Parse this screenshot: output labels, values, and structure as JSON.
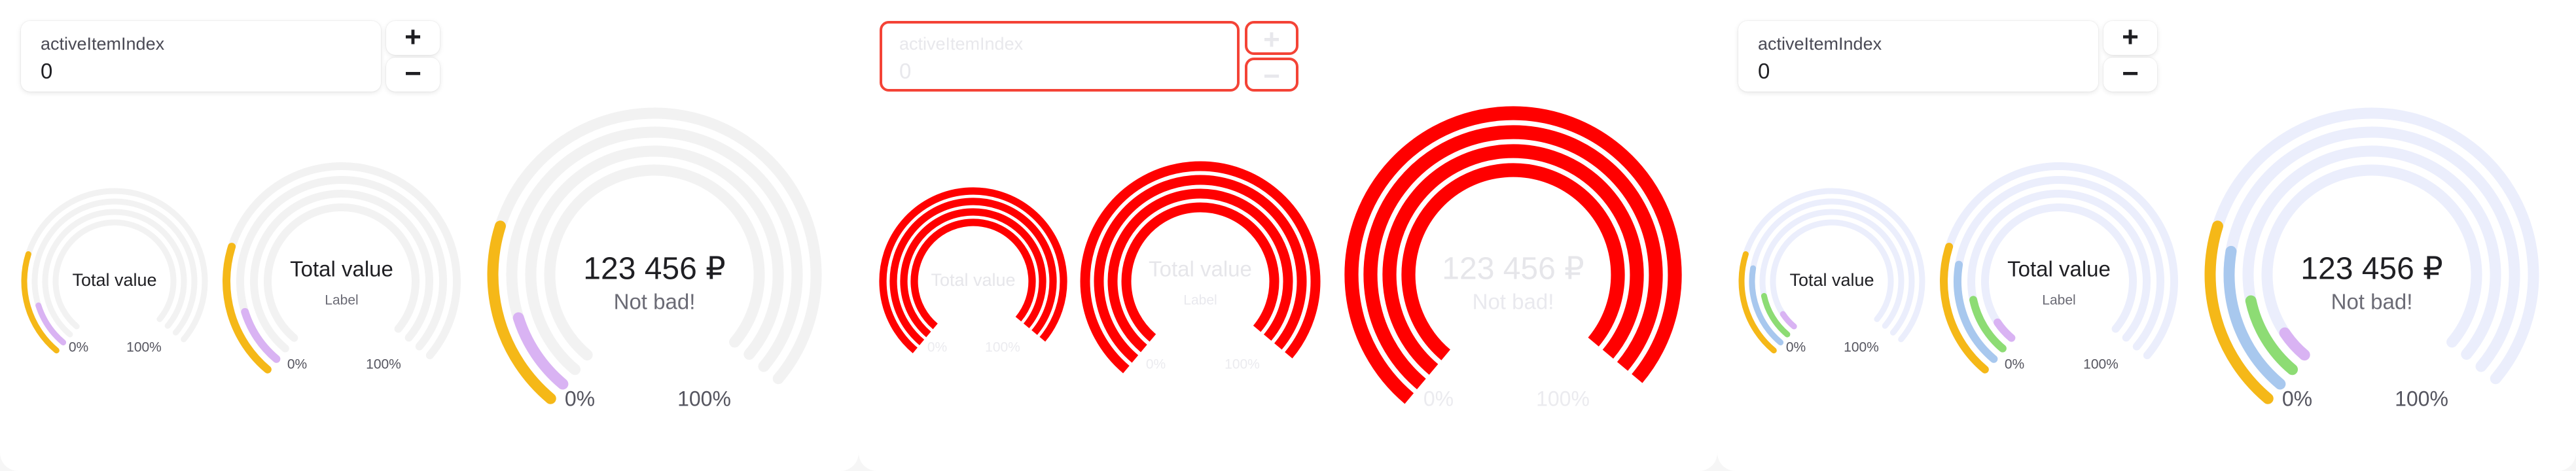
{
  "colors": {
    "track_light": "#f2f2f2",
    "track_blue": "#ebeefc",
    "orange": "#f5b818",
    "purple": "#d9b3f3",
    "green": "#8ddc74",
    "blue": "#a8c8ee",
    "error_red": "#ff0000"
  },
  "panels": [
    {
      "variant": "default",
      "stepper": {
        "label": "activeItemIndex",
        "value": "0",
        "plus": "+",
        "minus": "−"
      },
      "gauges": [
        {
          "size": "small",
          "title": "Total value",
          "min_label": "0%",
          "max_label": "100%",
          "rings": [
            {
              "fraction": 0.25,
              "color": "orange"
            },
            {
              "fraction": 0.12,
              "color": "purple"
            },
            {
              "fraction": 0,
              "color": "none"
            },
            {
              "fraction": 0,
              "color": "none"
            }
          ]
        },
        {
          "size": "medium",
          "title": "Total value",
          "subtitle": "Label",
          "min_label": "0%",
          "max_label": "100%",
          "rings": [
            {
              "fraction": 0.25,
              "color": "orange"
            },
            {
              "fraction": 0.12,
              "color": "purple"
            },
            {
              "fraction": 0,
              "color": "none"
            },
            {
              "fraction": 0,
              "color": "none"
            }
          ]
        },
        {
          "size": "large",
          "title": "123 456 ₽",
          "subtitle": "Not bad!",
          "min_label": "0%",
          "max_label": "100%",
          "rings": [
            {
              "fraction": 0.25,
              "color": "orange"
            },
            {
              "fraction": 0.12,
              "color": "purple"
            },
            {
              "fraction": 0,
              "color": "none"
            },
            {
              "fraction": 0,
              "color": "none"
            }
          ]
        }
      ]
    },
    {
      "variant": "error",
      "stepper": {
        "label": "activeItemIndex",
        "value": "0",
        "plus": "+",
        "minus": "−"
      },
      "gauges": [
        {
          "size": "small",
          "title": "Total value",
          "min_label": "0%",
          "max_label": "100%",
          "rings": [
            {
              "fraction": 1,
              "color": "error_red"
            },
            {
              "fraction": 1,
              "color": "error_red"
            },
            {
              "fraction": 1,
              "color": "error_red"
            },
            {
              "fraction": 1,
              "color": "error_red"
            }
          ]
        },
        {
          "size": "medium",
          "title": "Total value",
          "subtitle": "Label",
          "min_label": "0%",
          "max_label": "100%",
          "rings": [
            {
              "fraction": 1,
              "color": "error_red"
            },
            {
              "fraction": 1,
              "color": "error_red"
            },
            {
              "fraction": 1,
              "color": "error_red"
            },
            {
              "fraction": 1,
              "color": "error_red"
            }
          ]
        },
        {
          "size": "large",
          "title": "123 456 ₽",
          "subtitle": "Not bad!",
          "min_label": "0%",
          "max_label": "100%",
          "rings": [
            {
              "fraction": 1,
              "color": "error_red"
            },
            {
              "fraction": 1,
              "color": "error_red"
            },
            {
              "fraction": 1,
              "color": "error_red"
            },
            {
              "fraction": 1,
              "color": "error_red"
            }
          ]
        }
      ]
    },
    {
      "variant": "colored",
      "stepper": {
        "label": "activeItemIndex",
        "value": "0",
        "plus": "+",
        "minus": "−"
      },
      "gauges": [
        {
          "size": "small",
          "title": "Total value",
          "min_label": "0%",
          "max_label": "100%",
          "rings": [
            {
              "fraction": 0.25,
              "color": "orange"
            },
            {
              "fraction": 0.22,
              "color": "blue"
            },
            {
              "fraction": 0.14,
              "color": "green"
            },
            {
              "fraction": 0.06,
              "color": "purple"
            }
          ]
        },
        {
          "size": "medium",
          "title": "Total value",
          "subtitle": "Label",
          "min_label": "0%",
          "max_label": "100%",
          "rings": [
            {
              "fraction": 0.25,
              "color": "orange"
            },
            {
              "fraction": 0.22,
              "color": "blue"
            },
            {
              "fraction": 0.14,
              "color": "green"
            },
            {
              "fraction": 0.06,
              "color": "purple"
            }
          ]
        },
        {
          "size": "large",
          "title": "123 456 ₽",
          "subtitle": "Not bad!",
          "min_label": "0%",
          "max_label": "100%",
          "rings": [
            {
              "fraction": 0.25,
              "color": "orange"
            },
            {
              "fraction": 0.22,
              "color": "blue"
            },
            {
              "fraction": 0.14,
              "color": "green"
            },
            {
              "fraction": 0.06,
              "color": "purple"
            }
          ]
        }
      ]
    }
  ]
}
